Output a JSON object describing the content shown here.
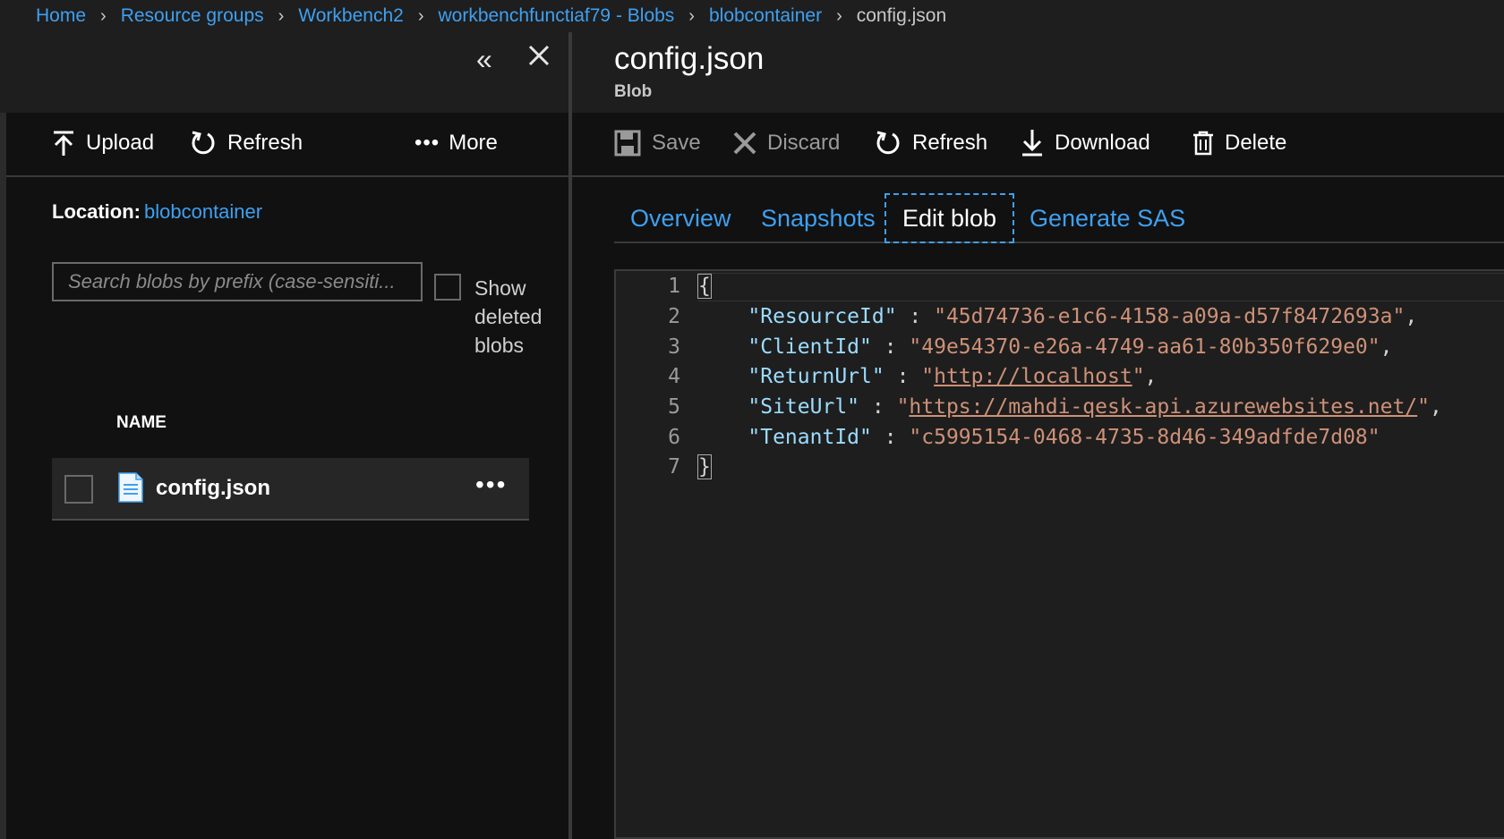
{
  "breadcrumb": {
    "items": [
      "Home",
      "Resource groups",
      "Workbench2",
      "workbenchfunctiaf79 - Blobs",
      "blobcontainer"
    ],
    "current": "config.json"
  },
  "left": {
    "toolbar": {
      "upload": "Upload",
      "refresh": "Refresh",
      "more": "More"
    },
    "location_label": "Location:",
    "location_value": "blobcontainer",
    "search_placeholder": "Search blobs by prefix (case-sensiti...",
    "show_deleted": "Show deleted blobs",
    "column_name": "NAME",
    "blobs": [
      {
        "name": "config.json"
      }
    ]
  },
  "right": {
    "title": "config.json",
    "subtitle": "Blob",
    "toolbar": {
      "save": "Save",
      "discard": "Discard",
      "refresh": "Refresh",
      "download": "Download",
      "delete": "Delete"
    },
    "tabs": [
      "Overview",
      "Snapshots",
      "Edit blob",
      "Generate SAS"
    ],
    "active_tab": "Edit blob",
    "editor": {
      "line_numbers": [
        "1",
        "2",
        "3",
        "4",
        "5",
        "6",
        "7"
      ],
      "entries": [
        {
          "key": "\"ResourceId\"",
          "value": "\"45d74736-e1c6-4158-a09a-d57f8472693a\""
        },
        {
          "key": "\"ClientId\"",
          "value": "\"49e54370-e26a-4749-aa61-80b350f629e0\""
        },
        {
          "key": "\"ReturnUrl\"",
          "value": "http://localhost"
        },
        {
          "key": "\"SiteUrl\"",
          "value": "https://mahdi-qesk-api.azurewebsites.net/"
        },
        {
          "key": "\"TenantId\"",
          "value": "\"c5995154-0468-4735-8d46-349adfde7d08\""
        }
      ]
    }
  },
  "colors": {
    "accent": "#3fa0f0",
    "background": "#111111",
    "json_key": "#9cdcfe",
    "json_string": "#ce9178"
  }
}
